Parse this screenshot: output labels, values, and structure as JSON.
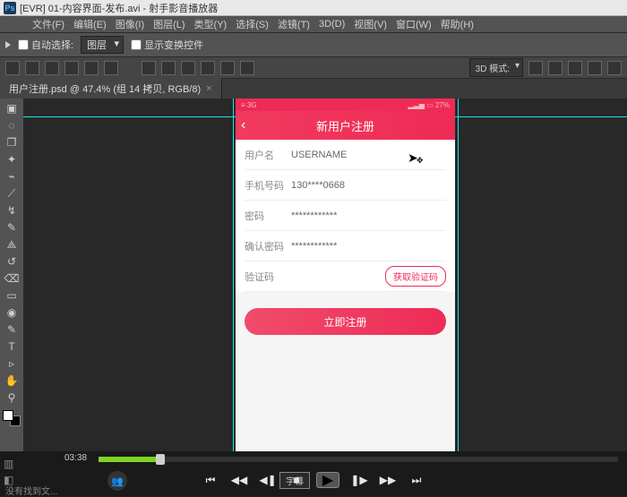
{
  "window": {
    "title": "[EVR] 01-内容界面-发布.avi - 射手影音播放器",
    "app_icon_text": "Ps"
  },
  "menubar": [
    "文件(F)",
    "编辑(E)",
    "图像(I)",
    "图层(L)",
    "类型(Y)",
    "选择(S)",
    "滤镜(T)",
    "3D(D)",
    "视图(V)",
    "窗口(W)",
    "帮助(H)"
  ],
  "optbar": {
    "auto_select_label": "自动选择:",
    "auto_select_checked": false,
    "layer_dropdown": "图层",
    "show_transform_label": "显示变换控件",
    "show_transform_checked": false,
    "mode3d_label": "3D 模式:"
  },
  "doc_tab": {
    "label": "用户注册.psd @ 47.4% (组 14 拷贝, RGB/8)"
  },
  "tools": [
    "▣",
    "◌",
    "❐",
    "✦",
    "⌁",
    "⟋",
    "↯",
    "✎",
    "⟁",
    "↺",
    "⌫",
    "▭",
    "◉",
    "✎",
    "T",
    "▹",
    "✋",
    "⚲"
  ],
  "phone": {
    "status_left": "≡ 3G",
    "status_right": "▂▃▅  ▭ 27%",
    "nav_title": "新用户注册",
    "back_icon": "‹",
    "rows": {
      "username": {
        "label": "用户名",
        "value": "USERNAME"
      },
      "phone": {
        "label": "手机号码",
        "value": "130****0668"
      },
      "password": {
        "label": "密码",
        "value": "************"
      },
      "confirm": {
        "label": "确认密码",
        "value": "************"
      },
      "code": {
        "label": "验证码",
        "button": "获取验证码"
      }
    },
    "register_button": "立即注册"
  },
  "player": {
    "time": "03:38",
    "progress_pct": 11,
    "subtitle_button": "字幕"
  },
  "footer": "没有找到文..."
}
